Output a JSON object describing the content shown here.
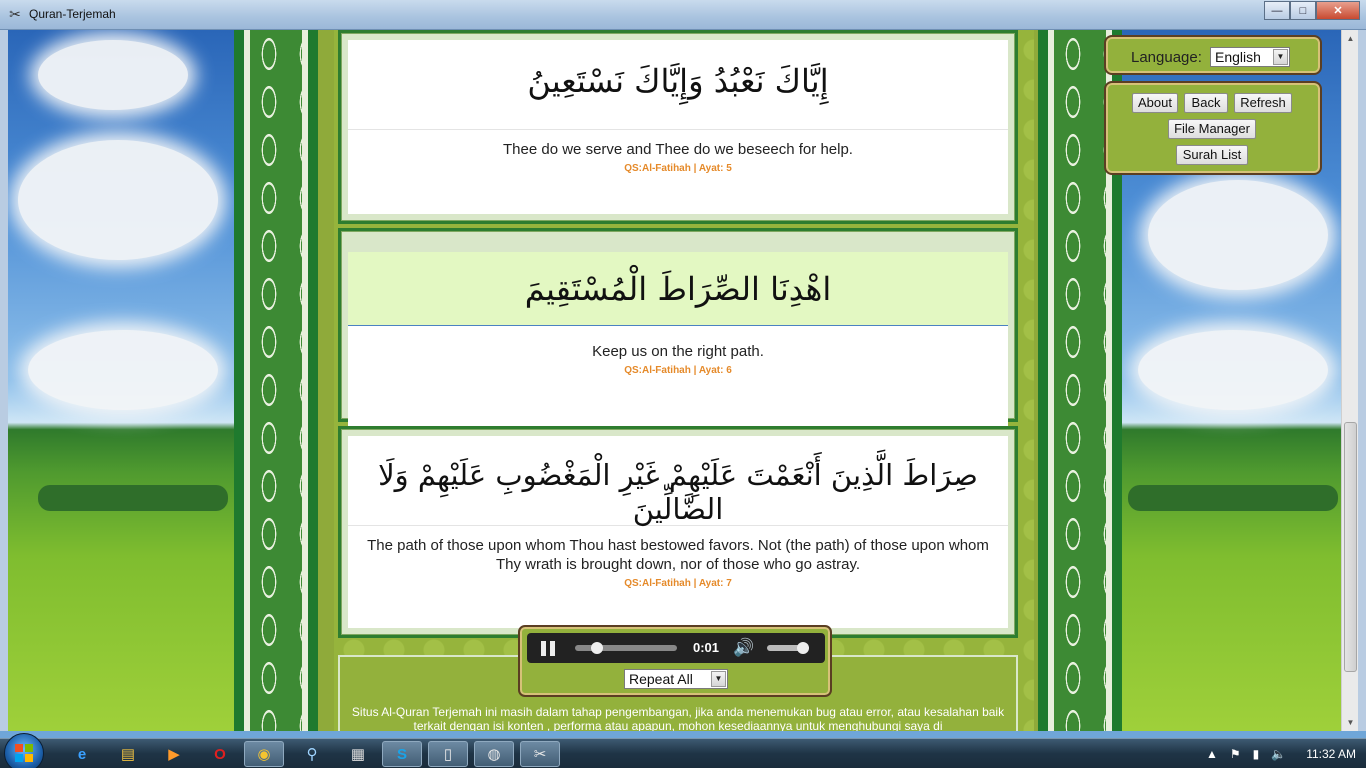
{
  "window": {
    "title": "Quran-Terjemah",
    "controls": {
      "minimize": "—",
      "maximize": "□",
      "close": "✕"
    }
  },
  "language": {
    "label": "Language:",
    "selected": "English"
  },
  "nav": {
    "about": "About",
    "back": "Back",
    "refresh": "Refresh",
    "file_manager": "File Manager",
    "surah_list": "Surah List"
  },
  "verses": [
    {
      "arabic": "إِيَّاكَ نَعْبُدُ وَإِيَّاكَ نَسْتَعِينُ",
      "translation": "Thee do we serve and Thee do we beseech for help.",
      "ref": "QS:Al-Fatihah | Ayat: 5"
    },
    {
      "arabic": "اهْدِنَا الصِّرَاطَ الْمُسْتَقِيمَ",
      "translation": "Keep us on the right path.",
      "ref": "QS:Al-Fatihah | Ayat: 6"
    },
    {
      "arabic": "صِرَاطَ الَّذِينَ أَنْعَمْتَ عَلَيْهِمْ غَيْرِ الْمَغْضُوبِ عَلَيْهِمْ وَلَا الضَّالِّينَ",
      "translation": "The path of those upon whom Thou hast bestowed favors. Not (the path) of those upon whom Thy wrath is brought down, nor of those who go astray.",
      "ref": "QS:Al-Fatihah | Ayat: 7"
    }
  ],
  "player": {
    "time": "0:01",
    "progress": 0.22,
    "volume": 0.85,
    "repeat": "Repeat All"
  },
  "footer": {
    "text": "Situs Al-Quran Terjemah ini masih dalam tahap pengembangan, jika anda menemukan bug atau error, atau kesalahan baik terkait dengan isi konten , performa atau apapun, mohon kesediaannya untuk menghubungi saya di"
  },
  "taskbar": {
    "clock": "11:32 AM"
  },
  "icons": [
    "app-icon",
    "pause-icon",
    "volume-icon",
    "ie-icon",
    "explorer-icon",
    "media-player-icon",
    "opera-icon",
    "chrome-icon",
    "search-icon",
    "calculator-icon",
    "skype-icon",
    "notepad-icon",
    "window-icon",
    "quran-app-icon",
    "flag-icon",
    "network-icon",
    "speaker-icon"
  ]
}
